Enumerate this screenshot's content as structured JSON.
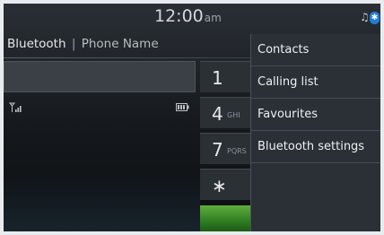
{
  "status_bar": {
    "time": "12:00",
    "ampm": "am",
    "icons": [
      "music-note-icon",
      "bluetooth-icon"
    ],
    "bluetooth_glyph": "✱"
  },
  "header": {
    "title": "Bluetooth",
    "separator": "|",
    "phone_name": "Phone Name"
  },
  "keypad": {
    "keys": [
      {
        "digit": "1",
        "letters": ""
      },
      {
        "digit": "4",
        "letters": "GHI"
      },
      {
        "digit": "7",
        "letters": "PQRS"
      },
      {
        "digit": "∗",
        "letters": ""
      }
    ]
  },
  "menu": {
    "items": [
      {
        "label": "Contacts"
      },
      {
        "label": "Calling list"
      },
      {
        "label": "Favourites"
      },
      {
        "label": "Bluetooth settings"
      }
    ]
  },
  "colors": {
    "accent_bluetooth": "#1e7fd8",
    "call_green": "#4a9c30",
    "background": "#15191d"
  }
}
